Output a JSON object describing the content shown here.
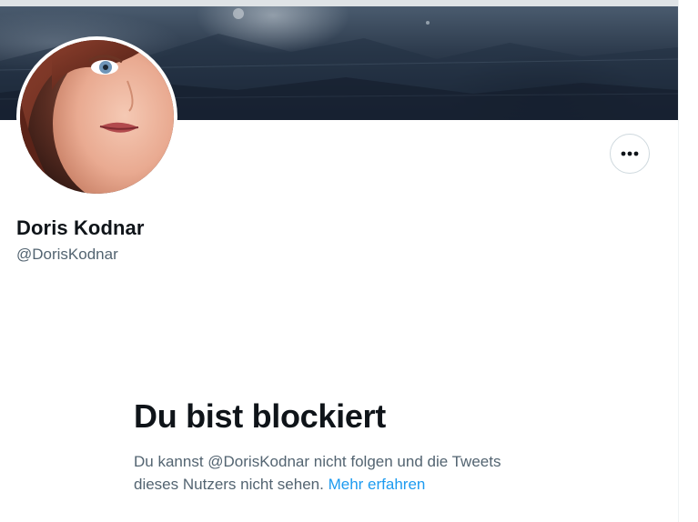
{
  "profile": {
    "display_name": "Doris Kodnar",
    "handle": "@DorisKodnar"
  },
  "actions": {
    "more_icon": "more-horizontal-icon"
  },
  "blocked": {
    "title": "Du bist blockiert",
    "desc_line1": "Du kannst @DorisKodnar nicht folgen und die Tweets",
    "desc_line2": "dieses Nutzers nicht sehen.",
    "link_text": "Mehr erfahren"
  },
  "colors": {
    "text_primary": "#0f1419",
    "text_secondary": "#536471",
    "link": "#1d9bf0",
    "border": "#cfd9de"
  }
}
